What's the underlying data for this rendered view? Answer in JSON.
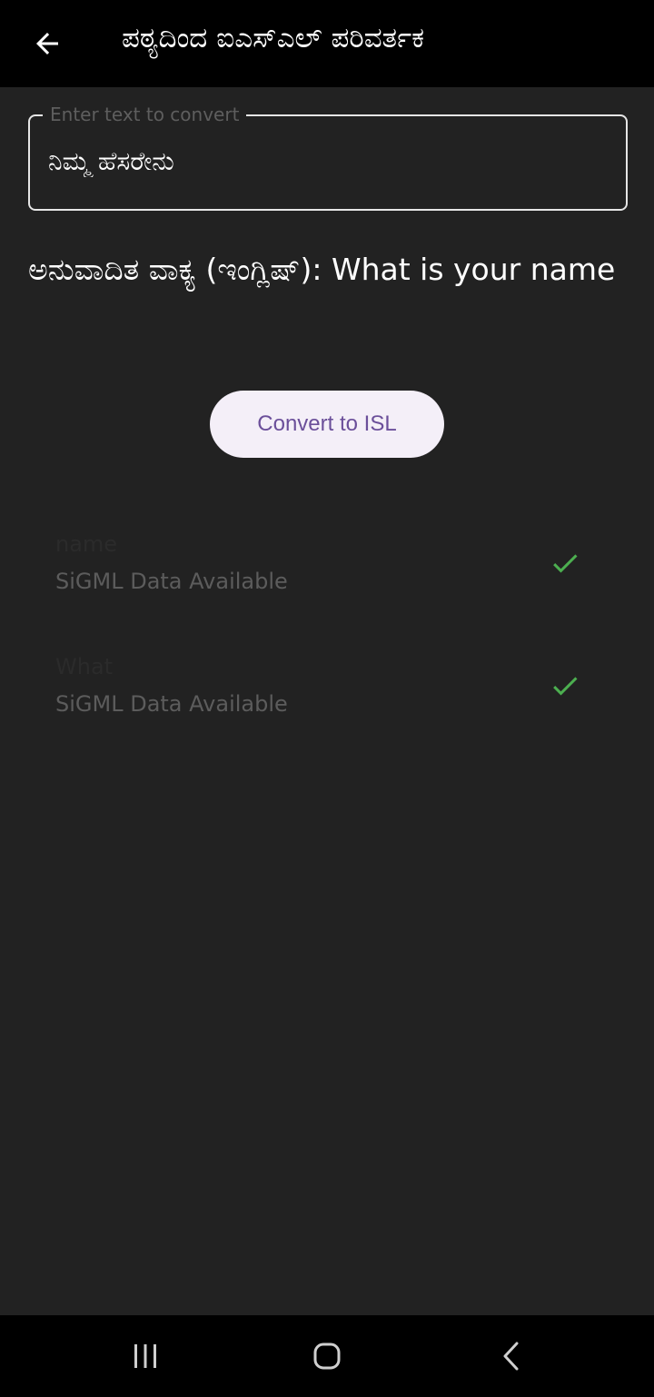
{
  "app_bar": {
    "title": "ಪಠ್ಯದಿಂದ ಐಎಸ್‌ಎಲ್ ಪರಿವರ್ತಕ",
    "back_icon": "arrow-back-icon"
  },
  "input": {
    "label": "Enter text to convert",
    "value": "ನಿಮ್ಮ ಹೆಸರೇನು"
  },
  "translated": {
    "text": "ಅನುವಾದಿತ ವಾಕ್ಯ (ಇಂಗ್ಲಿಷ್): What is your name"
  },
  "convert_button": {
    "label": "Convert to ISL"
  },
  "words": [
    {
      "word": "name",
      "status": "SiGML Data Available",
      "icon": "check-icon"
    },
    {
      "word": "What",
      "status": "SiGML Data Available",
      "icon": "check-icon"
    }
  ],
  "nav_bar": {
    "recents_icon": "recents-icon",
    "home_icon": "home-icon",
    "back_icon": "nav-back-icon"
  },
  "colors": {
    "background": "#222222",
    "app_bar": "#000000",
    "button_bg": "#f4eff8",
    "button_text": "#6b4f9a",
    "check": "#4caf50"
  }
}
